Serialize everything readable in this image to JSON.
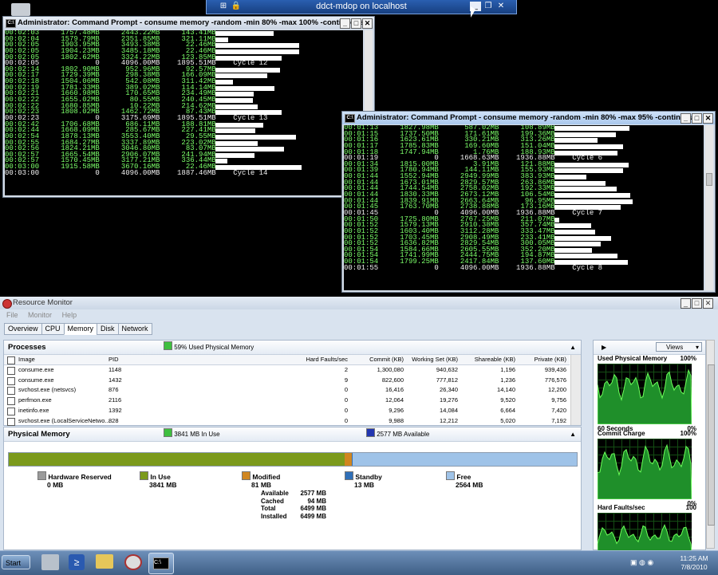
{
  "rdp": {
    "title": "ddct-mdop on localhost"
  },
  "cmd1": {
    "title": "Administrator: Command Prompt - consume  memory -random -min 80% -max 100% -continuous",
    "lines": [
      {
        "t": "00:02:03     1757.48MB     2443.22MB     143.41MB",
        "bar": 0.65
      },
      {
        "t": "00:02:04     1579.79MB     2351.85MB     321.11MB",
        "bar": 0.14
      },
      {
        "t": "00:02:05     1903.95MB     3493.38MB      22.46MB",
        "bar": 0.94
      },
      {
        "t": "00:02:05     1904.23MB     3485.18MB      22.46MB",
        "bar": 0.94
      },
      {
        "t": "00:02:05     1802.62MB     3324.22MB     123.85MB",
        "bar": 0.74
      },
      {
        "t": "00:02:05             0     4096.00MB    1895.51MB    Cycle 12",
        "w": true
      },
      {
        "t": "00:02:14     1802.90MB      952.96MB      92.57MB",
        "bar": 0.72
      },
      {
        "t": "00:02:17     1729.39MB      298.38MB     166.09MB",
        "bar": 0.58
      },
      {
        "t": "00:02:18     1504.06MB      542.08MB     311.42MB",
        "bar": 0.2
      },
      {
        "t": "00:02:19     1781.33MB      389.02MB     114.14MB",
        "bar": 0.66
      },
      {
        "t": "00:02:21     1660.98MB      170.65MB     234.49MB",
        "bar": 0.43
      },
      {
        "t": "00:02:22     1655.02MB       80.55MB     240.45MB",
        "bar": 0.42
      },
      {
        "t": "00:02:22     1680.85MB       10.22MB     214.62MB",
        "bar": 0.47
      },
      {
        "t": "00:02:23     1808.02MB     1462.72MB      87.43MB",
        "bar": 0.74
      },
      {
        "t": "00:02:23             0     3175.69MB    1895.51MB    Cycle 13",
        "w": true
      },
      {
        "t": "00:02:42     1706.68MB      686.11MB     188.81MB",
        "bar": 0.54
      },
      {
        "t": "00:02:44     1668.09MB      285.67MB     227.41MB",
        "bar": 0.45
      },
      {
        "t": "00:02:54     1878.13MB     3553.40MB      29.55MB",
        "bar": 0.9
      },
      {
        "t": "00:02:55     1684.27MB     3337.89MB     223.02MB",
        "bar": 0.47
      },
      {
        "t": "00:02:56     1824.21MB     3046.80MB      83.07MB",
        "bar": 0.77
      },
      {
        "t": "00:02:57     1665.54MB     2906.07MB     241.94MB",
        "bar": 0.44
      },
      {
        "t": "00:02:57     1570.45MB     3177.21MB     336.44MB",
        "bar": 0.13
      },
      {
        "t": "00:03:00     1915.58MB     3670.16MB      22.46MB",
        "bar": 0.96
      },
      {
        "t": "00:03:00             0     4096.00MB    1887.46MB    Cycle 14",
        "w": true
      }
    ]
  },
  "cmd2": {
    "title": "Administrator: Command Prompt - consume  memory -random -min 80% -max 95% -continuous",
    "lines": [
      {
        "t": "00:01:13     1827.98MB      587.02MB     108.89MB",
        "bar": 0.82
      },
      {
        "t": "00:01:15     1737.50MB      171.61MB     199.36MB",
        "bar": 0.67
      },
      {
        "t": "00:01:16     1623.61MB      330.21MB     313.26MB",
        "bar": 0.47
      },
      {
        "t": "00:01:17     1785.83MB      169.60MB     151.04MB",
        "bar": 0.75
      },
      {
        "t": "00:01:18     1747.94MB        1.76MB     188.93MB",
        "bar": 0.69
      },
      {
        "t": "00:01:19             0     1668.63MB    1936.88MB    Cycle 6",
        "w": true
      },
      {
        "t": "00:01:34     1815.00MB        3.91MB     121.88MB",
        "bar": 0.81
      },
      {
        "t": "00:01:39     1780.94MB      144.11MB     155.93MB",
        "bar": 0.75
      },
      {
        "t": "00:01:44     1552.94MB     2949.99MB     383.93MB",
        "bar": 0.35
      },
      {
        "t": "00:01:44     1673.01MB     2829.57MB     263.86MB",
        "bar": 0.56
      },
      {
        "t": "00:01:44     1744.54MB     2758.02MB     192.33MB",
        "bar": 0.68
      },
      {
        "t": "00:01:44     1830.33MB     2673.12MB     106.54MB",
        "bar": 0.83
      },
      {
        "t": "00:01:44     1839.91MB     2663.64MB      96.95MB",
        "bar": 0.85
      },
      {
        "t": "00:01:45     1763.70MB     2738.88MB     173.16MB",
        "bar": 0.72
      },
      {
        "t": "00:01:45             0     4096.00MB    1936.88MB    Cycle 7",
        "w": true
      },
      {
        "t": "00:01:50     1725.80MB     2767.25MB     211.07MB",
        "bar": 0.05
      },
      {
        "t": "00:01:52     1579.13MB     2910.38MB     357.74MB",
        "bar": 0.4
      },
      {
        "t": "00:01:52     1603.40MB     3112.28MB     333.47MB",
        "bar": 0.44
      },
      {
        "t": "00:01:52     1703.45MB     2908.49MB     233.41MB",
        "bar": 0.62
      },
      {
        "t": "00:01:52     1636.82MB     2829.54MB     300.05MB",
        "bar": 0.5
      },
      {
        "t": "00:01:54     1584.66MB     2605.55MB     352.20MB",
        "bar": 0.41
      },
      {
        "t": "00:01:54     1741.99MB     2444.75MB     194.87MB",
        "bar": 0.69
      },
      {
        "t": "00:01:54     1799.25MB     2417.84MB     137.60MB",
        "bar": 0.8
      },
      {
        "t": "00:01:55             0     4096.00MB    1936.88MB    Cycle 8",
        "w": true
      }
    ]
  },
  "resmon": {
    "title": "Resource Monitor",
    "menu": [
      "File",
      "Monitor",
      "Help"
    ],
    "tabs": [
      "Overview",
      "CPU",
      "Memory",
      "Disk",
      "Network"
    ],
    "active_tab": "Memory",
    "processes": {
      "header": "Processes",
      "summary": "59% Used Physical Memory",
      "columns": [
        "Image",
        "PID",
        "Hard Faults/sec",
        "Commit (KB)",
        "Working Set (KB)",
        "Shareable (KB)",
        "Private (KB)"
      ],
      "rows": [
        [
          "consume.exe",
          "1148",
          "2",
          "1,300,080",
          "940,632",
          "1,196",
          "939,436"
        ],
        [
          "consume.exe",
          "1432",
          "9",
          "822,600",
          "777,812",
          "1,236",
          "776,576"
        ],
        [
          "svchost.exe (netsvcs)",
          "876",
          "0",
          "16,416",
          "26,340",
          "14,140",
          "12,200"
        ],
        [
          "perfmon.exe",
          "2116",
          "0",
          "12,064",
          "19,276",
          "9,520",
          "9,756"
        ],
        [
          "inetinfo.exe",
          "1392",
          "0",
          "9,296",
          "14,084",
          "6,664",
          "7,420"
        ],
        [
          "svchost.exe (LocalServiceNetwo...",
          "828",
          "0",
          "9,988",
          "12,212",
          "5,020",
          "7,192"
        ]
      ]
    },
    "physical": {
      "header": "Physical Memory",
      "in_use": "3841 MB In Use",
      "available": "2577 MB Available",
      "legend": [
        {
          "name": "Hardware Reserved",
          "val": "0 MB",
          "color": "#9a9a9a"
        },
        {
          "name": "In Use",
          "val": "3841 MB",
          "color": "#7b9a1c"
        },
        {
          "name": "Modified",
          "val": "81 MB",
          "color": "#d08620"
        },
        {
          "name": "Standby",
          "val": "13 MB",
          "color": "#2f6fb8"
        },
        {
          "name": "Free",
          "val": "2564 MB",
          "color": "#9fc3e8"
        }
      ],
      "stats": [
        {
          "k": "Available",
          "v": "2577 MB"
        },
        {
          "k": "Cached",
          "v": "94 MB"
        },
        {
          "k": "Total",
          "v": "6499 MB"
        },
        {
          "k": "Installed",
          "v": "6499 MB"
        }
      ],
      "bar_fractions": {
        "in_use": 0.591,
        "modified": 0.0125,
        "standby": 0.002,
        "free": 0.394
      }
    },
    "side": {
      "views": "Views",
      "graphs": [
        {
          "title": "Used Physical Memory",
          "max": "100%",
          "min": "0%",
          "footer": "60 Seconds"
        },
        {
          "title": "Commit Charge",
          "max": "100%",
          "min": "0%"
        },
        {
          "title": "Hard Faults/sec",
          "max": "100"
        }
      ]
    }
  },
  "taskbar": {
    "start": "Start",
    "time": "11:25 AM",
    "date": "7/8/2010"
  }
}
